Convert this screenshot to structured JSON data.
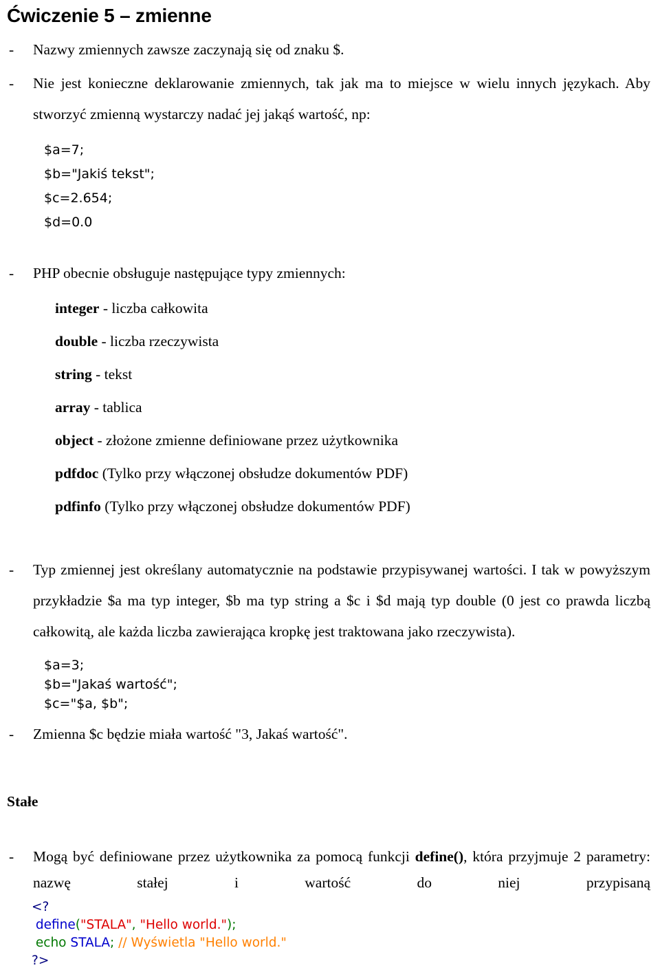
{
  "document": {
    "title": "Ćwiczenie 5 – zmienne",
    "intro_bullets": [
      {
        "dash": "-",
        "text": "Nazwy zmiennych zawsze zaczynają się od znaku $."
      },
      {
        "dash": "-",
        "text": "Nie jest konieczne deklarowanie zmiennych, tak jak ma to miejsce w wielu innych językach. Aby stworzyć zmienną wystarczy nadać jej jakąś wartość, np:"
      }
    ],
    "code_block_1": [
      "$a=7;",
      "$b=\"Jakiś tekst\";",
      "$c=2.654;",
      "$d=0.0"
    ],
    "types_intro": {
      "dash": "-",
      "text": "PHP obecnie obsługuje następujące typy zmiennych:"
    },
    "types": [
      {
        "name": "integer",
        "desc": "- liczba całkowita"
      },
      {
        "name": "double",
        "desc": "- liczba rzeczywista"
      },
      {
        "name": "string",
        "desc": "- tekst"
      },
      {
        "name": "array",
        "desc": "- tablica"
      },
      {
        "name": "object",
        "desc": "- złożone zmienne definiowane przez użytkownika"
      },
      {
        "name": "pdfdoc",
        "desc": "(Tylko przy włączonej obsłudze dokumentów PDF)"
      },
      {
        "name": "pdfinfo",
        "desc": "(Tylko przy włączonej obsłudze dokumentów PDF)"
      }
    ],
    "type_paragraph": {
      "dash": "-",
      "text": "Typ zmiennej jest określany automatycznie na podstawie przypisywanej wartości. I tak w powyższym przykładzie $a ma typ integer, $b ma typ string a $c i $d mają typ double (0 jest co prawda liczbą całkowitą, ale każda liczba zawierająca kropkę jest traktowana jako rzeczywista)."
    },
    "code_block_2": [
      "$a=3;",
      "$b=\"Jakaś wartość\";",
      "$c=\"$a, $b\";"
    ],
    "result_bullet": {
      "dash": "-",
      "text": "Zmienna $c będzie miała wartość \"3, Jakaś wartość\"."
    },
    "constants_heading": "Stałe",
    "constants_bullet": {
      "dash": "-",
      "part1": "Mogą być definiowane przez użytkownika za pomocą funkcji ",
      "bold": "define()",
      "part2": ", która przyjmuje 2 parametry: nazwę stałej i wartość do niej przypisaną"
    },
    "php_code": {
      "open_tag": "<?",
      "line_define": {
        "fn": "define",
        "open_paren": "(",
        "str1": "\"STALA\"",
        "comma": ", ",
        "str2": "\"Hello world.\"",
        "close": ");"
      },
      "line_echo": {
        "kw": "echo ",
        "const": "STALA",
        "semi": ";",
        "comment": " // Wyświetla \"Hello world.\""
      },
      "close_tag": "?>"
    },
    "colors": {
      "tag": "#000080",
      "function": "#0000CC",
      "punctuation": "#007700",
      "string": "#DD0000",
      "keyword": "#007700",
      "constant": "#0000CC",
      "comment": "#FF8000",
      "text": "#000000",
      "background": "#FFFFFF"
    }
  }
}
